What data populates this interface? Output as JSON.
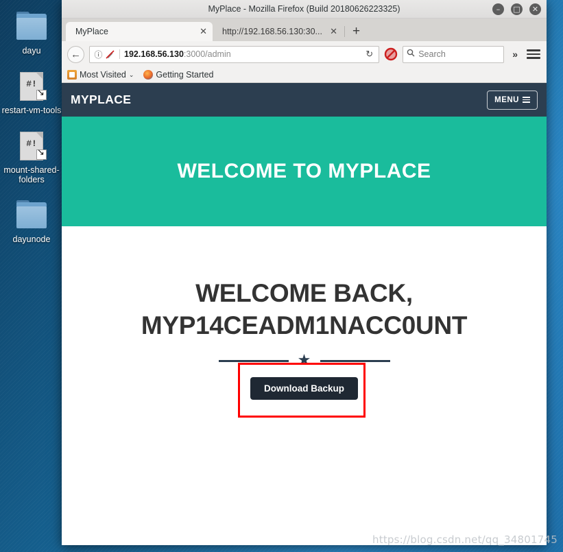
{
  "desktop": {
    "icons": [
      {
        "label": "dayu",
        "type": "folder",
        "icon": "folder-icon"
      },
      {
        "label": "restart-vm-tools",
        "type": "script",
        "icon": "script-file-icon",
        "glyph": "#!"
      },
      {
        "label": "mount-shared-folders",
        "type": "script",
        "icon": "script-file-icon",
        "glyph": "#!"
      },
      {
        "label": "dayunode",
        "type": "folder",
        "icon": "folder-icon"
      }
    ],
    "watermark": "https://blog.csdn.net/qq_34801745"
  },
  "browser": {
    "window_title": "MyPlace - Mozilla Firefox (Build 20180626223325)",
    "controls": {
      "minimize": "–",
      "maximize": "□",
      "close": "✕"
    },
    "tabs": [
      {
        "title": "MyPlace",
        "active": true,
        "close": "✕"
      },
      {
        "title": "http://192.168.56.130:30...",
        "active": false,
        "close": "✕"
      }
    ],
    "new_tab_label": "+",
    "toolbar": {
      "back_icon": "←",
      "info_icon": "ⓘ",
      "url_host": "192.168.56.130",
      "url_path": ":3000/admin",
      "reload_icon": "↻",
      "noscript_icon": "noscript-blocked-icon",
      "search_icon": "⌕",
      "search_placeholder": "Search",
      "search_value": "",
      "overflow_label": "»",
      "menu_icon": "hamburger-icon"
    },
    "bookmarks": [
      {
        "label": "Most Visited",
        "icon": "most-visited-icon",
        "caret": "⌄"
      },
      {
        "label": "Getting Started",
        "icon": "firefox-icon",
        "caret": ""
      }
    ]
  },
  "page": {
    "navbar": {
      "brand": "MYPLACE",
      "menu_label": "MENU"
    },
    "hero": {
      "title": "WELCOME TO MYPLACE",
      "background_color": "#1abc9c"
    },
    "main": {
      "heading_line1": "WELCOME BACK,",
      "heading_line2": "MYP14CEADM1NACC0UNT",
      "divider_star": "★",
      "download_button_label": "Download Backup"
    },
    "annotation": {
      "color": "#ff0000",
      "target": "Download Backup"
    }
  }
}
